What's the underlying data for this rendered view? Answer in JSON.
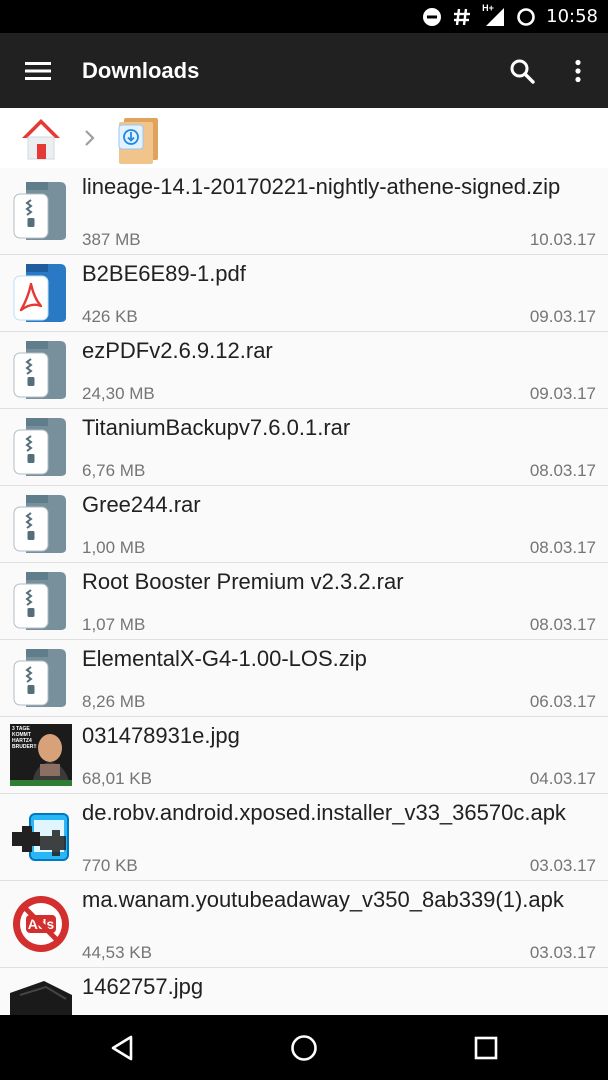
{
  "status_bar": {
    "time": "10:58",
    "network_label": "H+"
  },
  "app_bar": {
    "title": "Downloads"
  },
  "breadcrumb": {
    "items": [
      "home",
      "downloads"
    ]
  },
  "files": [
    {
      "name": "lineage-14.1-20170221-nightly-athene-signed.zip",
      "size": "387 MB",
      "date": "10.03.17",
      "icon": "archive-icon"
    },
    {
      "name": "B2BE6E89-1.pdf",
      "size": "426 KB",
      "date": "09.03.17",
      "icon": "pdf-icon"
    },
    {
      "name": "ezPDFv2.6.9.12.rar",
      "size": "24,30 MB",
      "date": "09.03.17",
      "icon": "archive-icon"
    },
    {
      "name": "TitaniumBackupv7.6.0.1.rar",
      "size": "6,76 MB",
      "date": "08.03.17",
      "icon": "archive-icon"
    },
    {
      "name": "Gree244.rar",
      "size": "1,00 MB",
      "date": "08.03.17",
      "icon": "archive-icon"
    },
    {
      "name": "Root Booster Premium v2.3.2.rar",
      "size": "1,07 MB",
      "date": "08.03.17",
      "icon": "archive-icon"
    },
    {
      "name": "ElementalX-G4-1.00-LOS.zip",
      "size": "8,26 MB",
      "date": "06.03.17",
      "icon": "archive-icon"
    },
    {
      "name": "031478931e.jpg",
      "size": "68,01 KB",
      "date": "04.03.17",
      "icon": "image-thumbnail",
      "thumb_text": "3 Tage KOMMT HARTZ4 BRUDER!!"
    },
    {
      "name": "de.robv.android.xposed.installer_v33_36570c.apk",
      "size": "770 KB",
      "date": "03.03.17",
      "icon": "xposed-app-icon"
    },
    {
      "name": "ma.wanam.youtubeadaway_v350_8ab339(1).apk",
      "size": "44,53 KB",
      "date": "03.03.17",
      "icon": "no-ads-app-icon",
      "icon_text": "Ads"
    },
    {
      "name": "1462757.jpg",
      "size": "",
      "date": "",
      "icon": "image-thumbnail"
    }
  ],
  "colors": {
    "app_bar": "#212121",
    "status_bar": "#000000",
    "background": "#fafafa",
    "secondary_text": "#757575",
    "pdf_blue": "#2a79c4",
    "archive_gray": "#78909c"
  }
}
